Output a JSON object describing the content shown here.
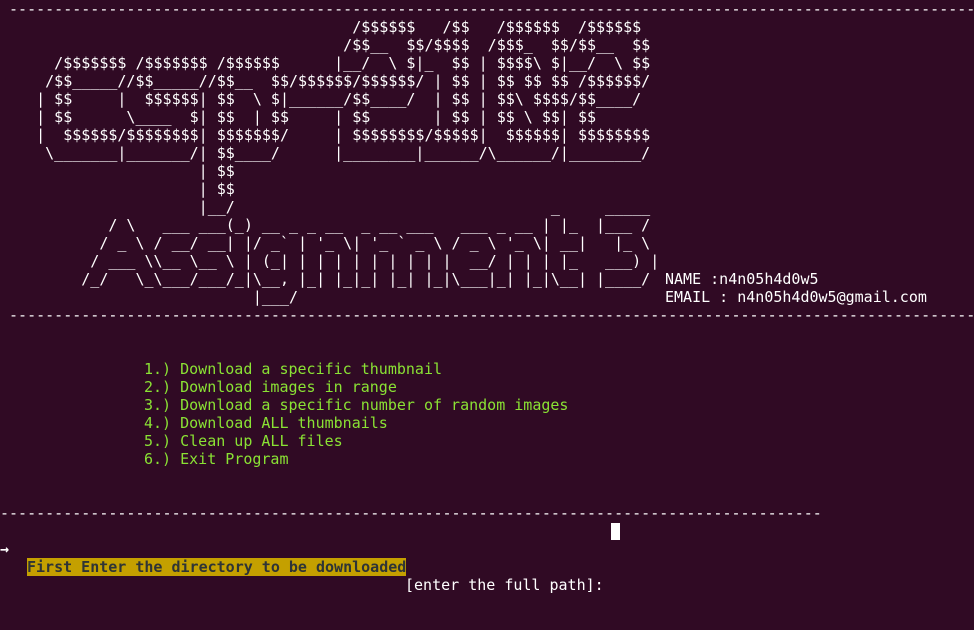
{
  "separators": {
    "top": " -----------------------------------------------------------------------------------------------------------",
    "middle": " -----------------------------------------------------------------------------------------------------------",
    "bottom": "-------------------------------------------------------------------------------------------"
  },
  "banner": {
    "logo_lines": [
      "                                       /$$$$$$   /$$   /$$$$$$  /$$$$$$",
      "                                      /$$__  $$/$$$$  /$$$_  $$/$$__  $$",
      "      /$$$$$$$ /$$$$$$$ /$$$$$$      |__/  \\ $|_  $$ | $$$$\\ $|__/  \\ $$",
      "     /$$_____//$$_____//$$__  $$/$$$$$$/$$$$$$/ | $$ | $$ $$ $$ /$$$$$$/",
      "    | $$     |  $$$$$$| $$  \\ $|______/$$____/  | $$ | $$\\ $$$$/$$____/",
      "    | $$      \\____  $| $$  | $$     | $$       | $$ | $$ \\ $$| $$",
      "    |  $$$$$$/$$$$$$$$| $$$$$$$/     | $$$$$$$$/$$$$$|  $$$$$$| $$$$$$$$",
      "     \\_______|_______/| $$____/      |________|______/\\______/|________/",
      "                      | $$",
      "                      | $$",
      "                      |__/                                   _     _____"
    ],
    "title_lines": [
      "            / \\   ___ ___(_) __ _ _ __  _ __ ___   ___ _ __ | |_  |___ /",
      "           / _ \\ / __/ __| |/ _` | '_ \\| '_ ` _ \\ / _ \\ '_ \\| __|   |_ \\",
      "          / ___ \\\\__ \\__ \\ | (_| | | | | | | | | |  __/ | | | |_   ___) |",
      "         /_/   \\_\\___/___/_|\\__, |_| |_|_| |_| |_|\\___|_| |_|\\__| |____/",
      "                            |___/"
    ],
    "name": "NAME :n4n05h4d0w5",
    "email": "EMAIL : n4n05h4d0w5@gmail.com"
  },
  "menu": {
    "items": [
      "1.) Download a specific thumbnail",
      "2.) Download images in range",
      "3.) Download a specific number of random images",
      "4.) Download ALL thumbnails",
      "5.) Clean up ALL files",
      "6.) Exit Program"
    ]
  },
  "prompt": {
    "arrow_icon": "→",
    "highlighted": "First Enter the directory to be downloaded",
    "rest": "[enter the full path]: ",
    "input_value": ""
  },
  "colors": {
    "background": "#300a24",
    "menu_text": "#8ae234",
    "highlight_bg": "#c4a000",
    "highlight_text": "#2e3436",
    "text": "#ffffff"
  }
}
